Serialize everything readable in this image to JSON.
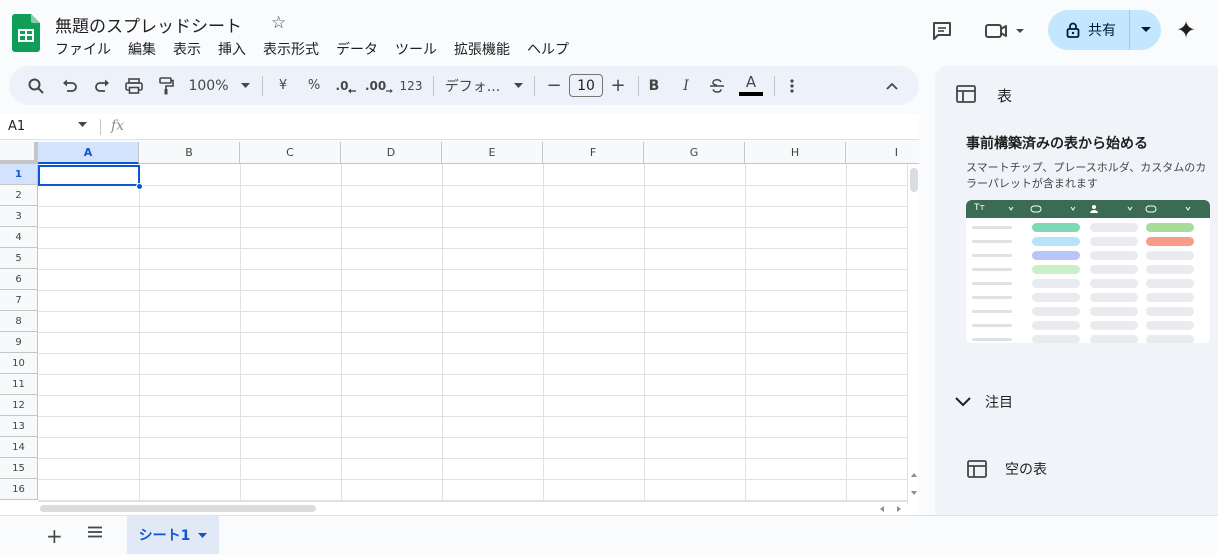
{
  "header": {
    "title": "無題のスプレッドシート",
    "menus": [
      "ファイル",
      "編集",
      "表示",
      "挿入",
      "表示形式",
      "データ",
      "ツール",
      "拡張機能",
      "ヘルプ"
    ],
    "share_label": "共有"
  },
  "toolbar": {
    "zoom": "100%",
    "currency": "¥",
    "percent": "%",
    "dec_decrease": ".0",
    "dec_increase": ".00",
    "number_format": "123",
    "font": "デフォ...",
    "font_size": "10",
    "minus": "−",
    "plus": "+",
    "bold": "B",
    "italic": "I",
    "text_color": "A"
  },
  "formula_bar": {
    "cell_ref": "A1",
    "fx": "fx"
  },
  "grid": {
    "columns": [
      "A",
      "B",
      "C",
      "D",
      "E",
      "F",
      "G",
      "H",
      "I"
    ],
    "rows": [
      "1",
      "2",
      "3",
      "4",
      "5",
      "6",
      "7",
      "8",
      "9",
      "10",
      "11",
      "12",
      "13",
      "14",
      "15",
      "16"
    ],
    "selected_cell": "A1"
  },
  "sheets": {
    "tabs": [
      "シート1"
    ]
  },
  "panel": {
    "title": "表",
    "heading": "事前構築済みの表から始める",
    "description": "スマートチップ、プレースホルダ、カスタムのカラーパレットが含まれます",
    "preview_header_label": "Tт",
    "focus_label": "注目",
    "empty_table_label": "空の表",
    "preview_pill_colors": [
      "#7fd8b5",
      "#b9e3fa",
      "#b7c5f8",
      "#c8efc7",
      "#e9ebee",
      "#e9ebee",
      "#e9ebee",
      "#e9ebee",
      "#e9ebee"
    ],
    "preview_right_colors": [
      "#a8dc9b",
      "#f79b8a",
      "#e9ebee",
      "#e9ebee",
      "#e9ebee",
      "#e9ebee",
      "#e9ebee",
      "#e9ebee",
      "#e9ebee"
    ]
  },
  "colors": {
    "accent": "#0b57d0",
    "share_bg": "#c2e7ff",
    "logo_green": "#0f9d58"
  }
}
